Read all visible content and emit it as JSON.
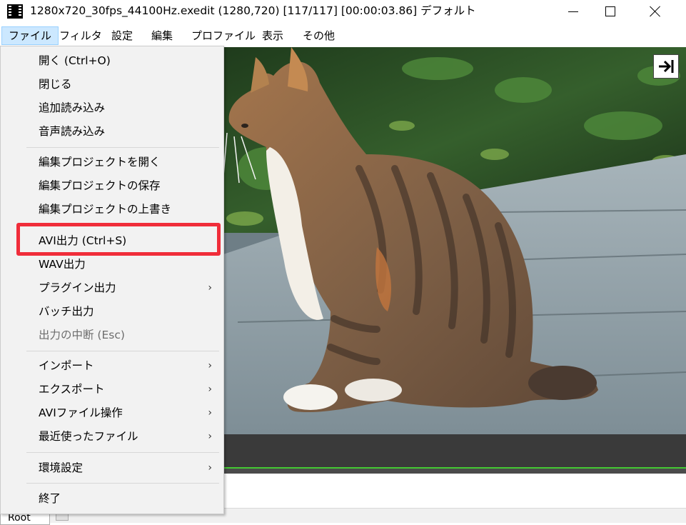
{
  "window": {
    "title": "1280x720_30fps_44100Hz.exedit (1280,720)  [117/117] [00:00:03.86]  デフォルト"
  },
  "menubar": {
    "items": [
      {
        "label": "ファイル"
      },
      {
        "label": "フィルタ"
      },
      {
        "label": "設定"
      },
      {
        "label": "編集"
      },
      {
        "label": "プロファイル"
      },
      {
        "label": "表示"
      },
      {
        "label": "その他"
      }
    ]
  },
  "file_menu": {
    "items": [
      {
        "label": "開く (Ctrl+O)"
      },
      {
        "label": "閉じる"
      },
      {
        "label": "追加読み込み"
      },
      {
        "label": "音声読み込み"
      },
      {
        "label": "編集プロジェクトを開く"
      },
      {
        "label": "編集プロジェクトの保存"
      },
      {
        "label": "編集プロジェクトの上書き"
      },
      {
        "label": "AVI出力 (Ctrl+S)",
        "highlighted": true
      },
      {
        "label": "WAV出力"
      },
      {
        "label": "プラグイン出力",
        "submenu": true
      },
      {
        "label": "バッチ出力"
      },
      {
        "label": "出力の中断 (Esc)",
        "disabled": true
      },
      {
        "label": "インポート",
        "submenu": true
      },
      {
        "label": "エクスポート",
        "submenu": true
      },
      {
        "label": "AVIファイル操作",
        "submenu": true
      },
      {
        "label": "最近使ったファイル",
        "submenu": true
      },
      {
        "label": "環境設定",
        "submenu": true
      },
      {
        "label": "終了"
      }
    ],
    "submenu_arrow": "›"
  },
  "timeline": {
    "root_label": "Root"
  },
  "colors": {
    "highlight_box": "#f02d3a",
    "menu_active_bg": "#cce8ff",
    "seek_line": "#44c832"
  },
  "icons": {
    "preview_dock": "arrow-to-right-bar-icon"
  }
}
